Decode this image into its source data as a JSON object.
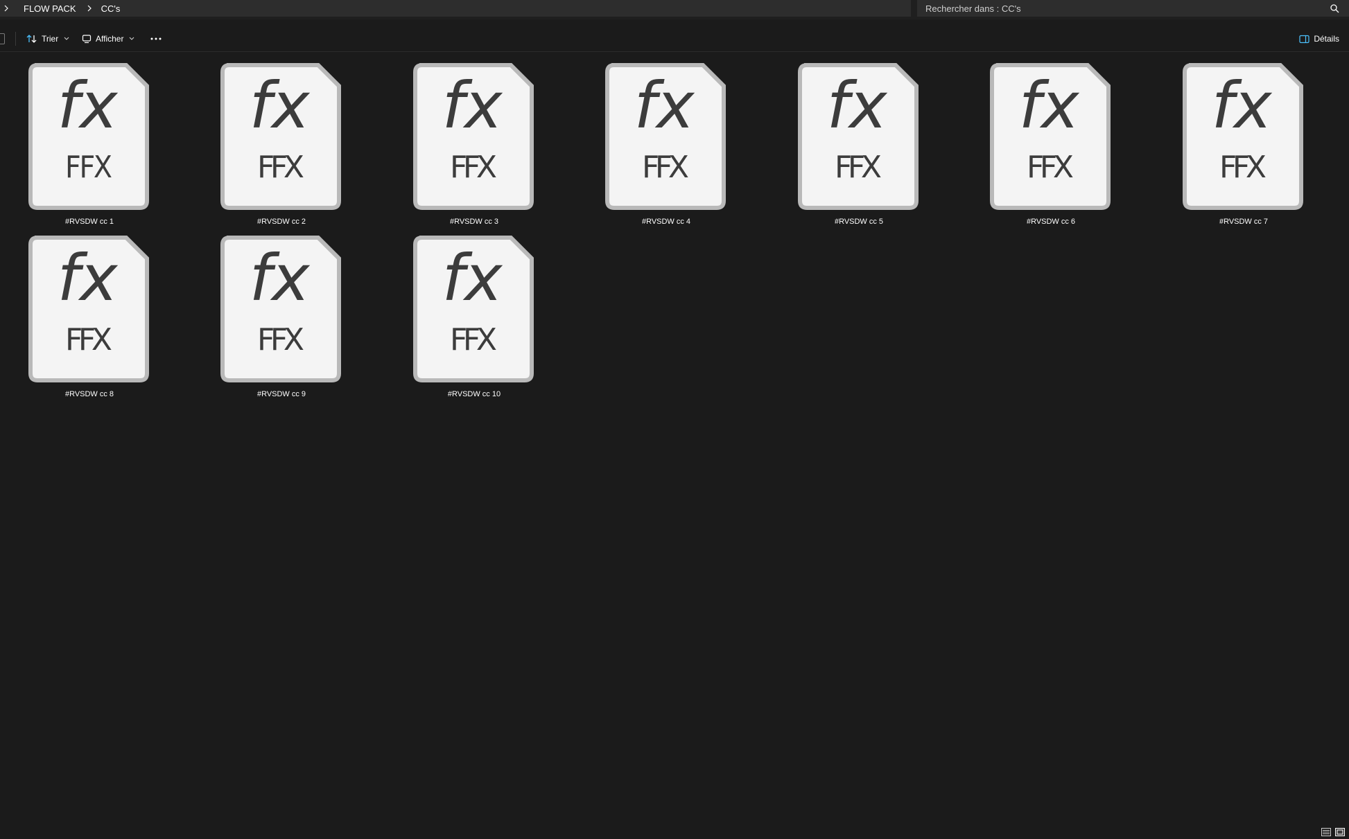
{
  "breadcrumb": {
    "items": [
      {
        "label": "FLOW PACK"
      },
      {
        "label": "CC's"
      }
    ]
  },
  "search": {
    "placeholder": "Rechercher dans : CC's",
    "icon": "search-icon"
  },
  "toolbar": {
    "sort_label": "Trier",
    "view_label": "Afficher",
    "more_icon": "more-icon",
    "details_label": "Détails"
  },
  "files": [
    {
      "name": "#RVSDW cc 1",
      "glyph": "fx",
      "ext": "FFX"
    },
    {
      "name": "#RVSDW cc 2",
      "glyph": "fx",
      "ext": "FFX"
    },
    {
      "name": "#RVSDW cc 3",
      "glyph": "fx",
      "ext": "FFX"
    },
    {
      "name": "#RVSDW cc 4",
      "glyph": "fx",
      "ext": "FFX"
    },
    {
      "name": "#RVSDW cc 5",
      "glyph": "fx",
      "ext": "FFX"
    },
    {
      "name": "#RVSDW cc 6",
      "glyph": "fx",
      "ext": "FFX"
    },
    {
      "name": "#RVSDW cc 7",
      "glyph": "fx",
      "ext": "FFX"
    },
    {
      "name": "#RVSDW cc 8",
      "glyph": "fx",
      "ext": "FFX"
    },
    {
      "name": "#RVSDW cc 9",
      "glyph": "fx",
      "ext": "FFX"
    },
    {
      "name": "#RVSDW cc 10",
      "glyph": "fx",
      "ext": "FFX"
    }
  ],
  "colors": {
    "background": "#1b1b1b",
    "bar": "#2d2d2d",
    "icon_page": "#f4f4f4",
    "icon_border": "#b9b9b9",
    "icon_text": "#3c3c3c",
    "accent": "#4cc2ff"
  }
}
